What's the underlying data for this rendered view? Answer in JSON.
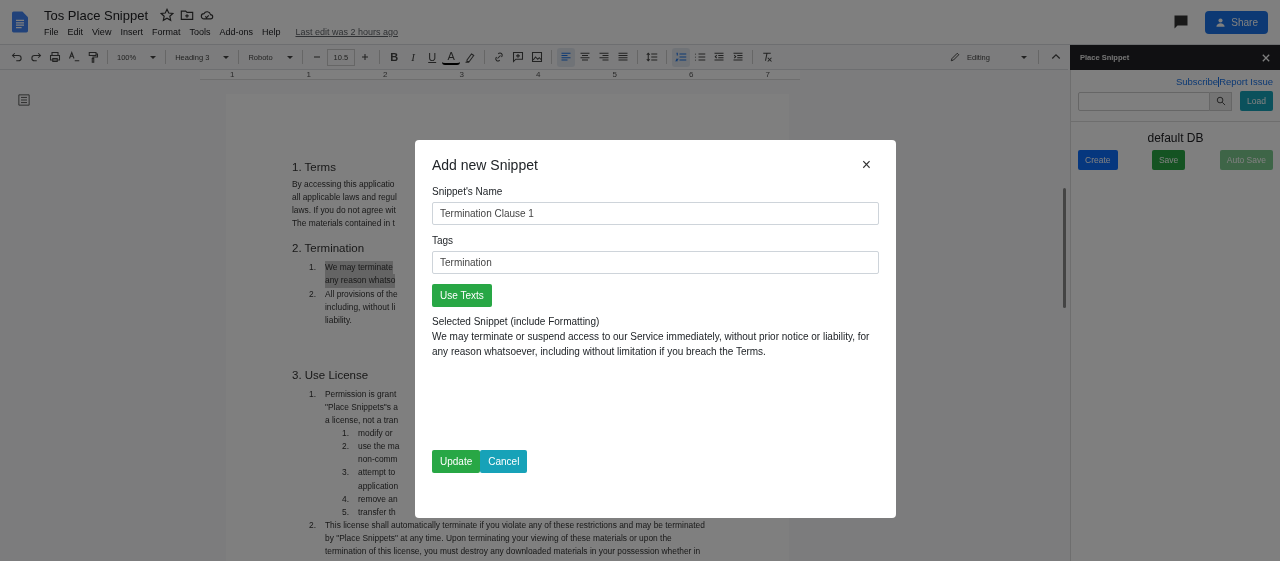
{
  "header": {
    "title": "Tos Place Snippet",
    "menus": [
      "File",
      "Edit",
      "View",
      "Insert",
      "Format",
      "Tools",
      "Add-ons",
      "Help"
    ],
    "last_edit": "Last edit was 2 hours ago",
    "share": "Share"
  },
  "toolbar": {
    "items": [
      {
        "kind": "undo",
        "selected": false
      },
      {
        "kind": "redo",
        "selected": false
      },
      {
        "kind": "print",
        "selected": false
      },
      {
        "kind": "spelling",
        "selected": false
      },
      {
        "kind": "paintformat",
        "selected": false
      },
      {
        "kind": "sep"
      },
      {
        "kind": "dropdown",
        "label": "100%"
      },
      {
        "kind": "sep"
      },
      {
        "kind": "dropdown",
        "label": "Heading 3"
      },
      {
        "kind": "sep"
      },
      {
        "kind": "dropdown",
        "label": "Roboto"
      },
      {
        "kind": "sep"
      },
      {
        "kind": "minus",
        "selected": false
      },
      {
        "kind": "size",
        "label": "10.5"
      },
      {
        "kind": "plus",
        "selected": false
      },
      {
        "kind": "sep"
      },
      {
        "kind": "bold",
        "label": "B",
        "selected": false
      },
      {
        "kind": "italic",
        "label": "I",
        "selected": false
      },
      {
        "kind": "underline",
        "label": "U",
        "selected": false
      },
      {
        "kind": "color",
        "label": "A",
        "selected": false
      },
      {
        "kind": "highlighter",
        "selected": false
      },
      {
        "kind": "sep"
      },
      {
        "kind": "link",
        "selected": false
      },
      {
        "kind": "comment",
        "selected": false
      },
      {
        "kind": "image",
        "selected": false
      },
      {
        "kind": "sep"
      },
      {
        "kind": "alignleft",
        "selected": true
      },
      {
        "kind": "aligncenter",
        "selected": false
      },
      {
        "kind": "alignright",
        "selected": false
      },
      {
        "kind": "justify",
        "selected": false
      },
      {
        "kind": "sep"
      },
      {
        "kind": "linespacing",
        "selected": false
      },
      {
        "kind": "sep"
      },
      {
        "kind": "numbered",
        "selected": true
      },
      {
        "kind": "bulleted",
        "selected": false
      },
      {
        "kind": "outdent",
        "selected": false
      },
      {
        "kind": "indent",
        "selected": false
      },
      {
        "kind": "sep"
      },
      {
        "kind": "clear",
        "selected": false
      }
    ],
    "mode": "Editing"
  },
  "ruler": [
    "1",
    "1",
    "2",
    "3",
    "4",
    "5",
    "6",
    "7"
  ],
  "document": [
    {
      "kind": "heading",
      "text": "1. Terms"
    },
    {
      "kind": "paragraph",
      "lines": [
        "By accessing this applicatio",
        "all applicable laws and regul",
        "laws. If you do not agree wit",
        "The materials contained in t"
      ]
    },
    {
      "kind": "heading",
      "text": "2. Termination"
    },
    {
      "kind": "list",
      "items": [
        {
          "number": "1.",
          "highlighted": true,
          "lines": [
            "We may terminate",
            "any reason whatso"
          ]
        },
        {
          "number": "2.",
          "highlighted": false,
          "lines": [
            "All provisions of the",
            "including, without li",
            "liability."
          ]
        }
      ]
    },
    {
      "kind": "heading",
      "text": "3. Use License"
    },
    {
      "kind": "list",
      "items": [
        {
          "number": "1.",
          "highlighted": false,
          "lines": [
            "Permission is grant",
            "\"Place Snippets\"s a",
            "a license, not a tran"
          ],
          "children": [
            {
              "number": "1.",
              "highlighted": false,
              "lines": [
                "modify or"
              ]
            },
            {
              "number": "2.",
              "highlighted": false,
              "lines": [
                "use the ma",
                "non-comm"
              ]
            },
            {
              "number": "3.",
              "highlighted": false,
              "lines": [
                "attempt to",
                "application"
              ]
            },
            {
              "number": "4.",
              "highlighted": false,
              "lines": [
                "remove an"
              ]
            },
            {
              "number": "5.",
              "highlighted": false,
              "lines": [
                "transfer th"
              ]
            }
          ]
        },
        {
          "number": "2.",
          "highlighted": false,
          "lines": [
            "This license shall automatically terminate if you violate any of these restrictions and may be terminated",
            "by \"Place Snippets\" at any time. Upon terminating your viewing of these materials or upon the",
            "termination of this license, you must destroy any downloaded materials in your possession whether in"
          ]
        }
      ]
    }
  ],
  "sidebar": {
    "title": "Place Snippet",
    "links": [
      "Subscribe",
      "Report Issue"
    ],
    "load": "Load",
    "db": "default DB",
    "buttons": [
      {
        "label": "Create",
        "kind": "primary",
        "disabled": false
      },
      {
        "label": "Save",
        "kind": "success",
        "disabled": false
      },
      {
        "label": "Auto Save",
        "kind": "success",
        "disabled": true
      }
    ]
  },
  "dialog": {
    "title": "Add new Snippet",
    "close": "×",
    "fields": [
      {
        "label": "Snippet's Name",
        "value": "Termination Clause 1"
      },
      {
        "label": "Tags",
        "value": "Termination"
      }
    ],
    "use_texts": "Use Texts",
    "selected_label": "Selected Snippet (include Formatting)",
    "selected_text": "We may terminate or suspend access to our Service immediately, without prior notice or liability, for any reason whatsoever, including without limitation if you breach the Terms.",
    "buttons": [
      {
        "label": "Update",
        "kind": "success"
      },
      {
        "label": "Cancel",
        "kind": "info"
      }
    ]
  }
}
